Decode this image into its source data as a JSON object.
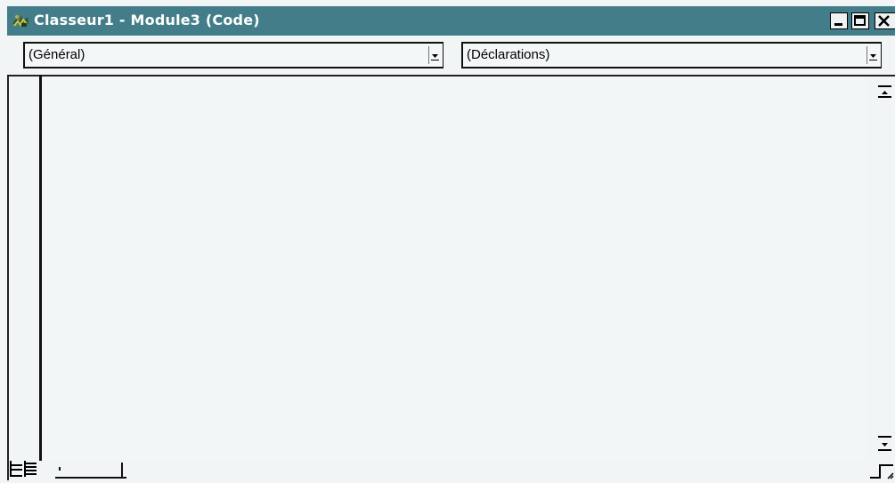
{
  "window": {
    "title": "Classeur1 - Module3 (Code)",
    "icon": "vba-code-module-icon",
    "title_bar_color": "#427d89",
    "controls": [
      "minimize-icon",
      "maximize-icon",
      "close-icon"
    ]
  },
  "combos": {
    "object": {
      "value": "(Général)"
    },
    "procedure": {
      "value": "(Déclarations)"
    }
  },
  "editor": {
    "code": ""
  },
  "bottom_bar": {
    "view_buttons": [
      "procedure-view-icon",
      "full-module-view-icon"
    ]
  }
}
